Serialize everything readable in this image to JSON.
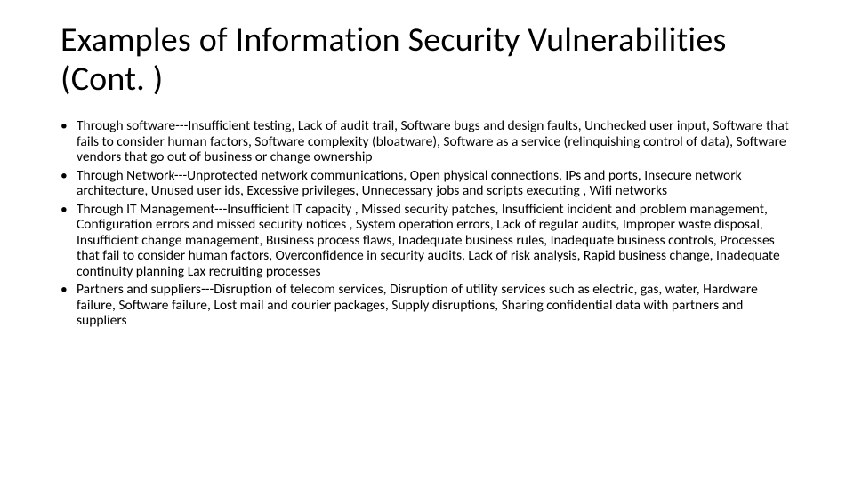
{
  "title": "Examples of Information Security Vulnerabilities (Cont. )",
  "bullets": [
    "Through software---Insufficient testing, Lack of audit trail, Software bugs and design faults, Unchecked user input, Software that fails to consider human factors, Software complexity (bloatware), Software as a service (relinquishing control of data), Software vendors that go out of business or change ownership",
    "Through Network---Unprotected network communications, Open physical connections, IPs and ports, Insecure network architecture, Unused user ids, Excessive privileges, Unnecessary jobs and scripts executing , Wifi networks",
    "Through IT Management---Insufficient IT capacity , Missed security patches, Insufficient incident and problem management, Configuration errors and missed security notices , System operation errors, Lack of regular audits, Improper waste disposal, Insufficient change management, Business process flaws, Inadequate business rules, Inadequate business controls, Processes that fail to consider human factors, Overconfidence in security audits, Lack of risk analysis, Rapid business change, Inadequate continuity planning Lax recruiting processes",
    "Partners and suppliers---Disruption of telecom services, Disruption of utility services such as electric, gas, water, Hardware failure, Software failure, Lost mail and courier packages, Supply disruptions, Sharing confidential data with partners and suppliers"
  ]
}
